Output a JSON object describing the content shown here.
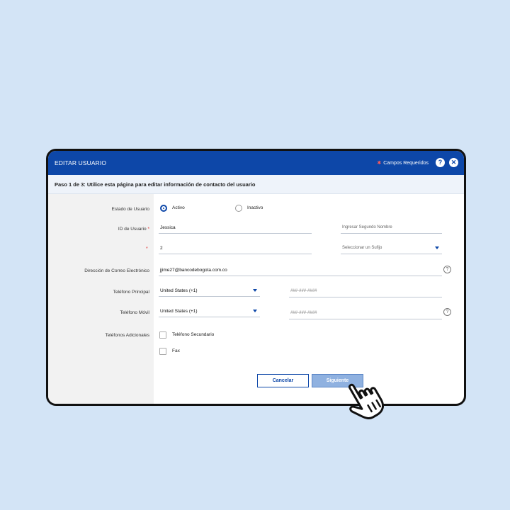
{
  "dialog": {
    "title": "EDITAR USUARIO",
    "required_note": "Campos Requeridos",
    "required_star": "✱",
    "help": "?",
    "close": "✕",
    "step_text": "Paso 1 de 3:  Utilice esta página para editar información de contacto del usuario"
  },
  "form": {
    "status_label": "Estado de Usuario",
    "status_options": [
      {
        "label": "Activo",
        "selected": true
      },
      {
        "label": "Inactivo",
        "selected": false
      }
    ],
    "user_id_label": "ID de Usuario",
    "required_mark": "*",
    "first_name_value": "Jessica",
    "second_name_placeholder": "Ingresar Segundo Nombre",
    "second_row_value": "2",
    "suffix_placeholder": "Seleccionar un Sufijo",
    "email_label": "Dirección de Correo Electrónico",
    "email_value": "jjime27@bancodebogota.com.co",
    "phone_main_label": "Teléfono Principal",
    "phone_main_country": "United States (+1)",
    "phone_main_placeholder": "###-###-####",
    "phone_mobile_label": "Teléfono Móvil",
    "phone_mobile_country": "United States (+1)",
    "phone_mobile_placeholder": "###-###-####",
    "additional_label": "Teléfonos Adicionales",
    "additional_options": [
      "Teléfono Secundario",
      "Fax"
    ],
    "help_glyph": "?"
  },
  "actions": {
    "cancel": "Cancelar",
    "next": "Siguiente"
  },
  "colors": {
    "background": "#d3e4f6",
    "header": "#0d47a8",
    "primary_button": "#8fb1e0"
  }
}
